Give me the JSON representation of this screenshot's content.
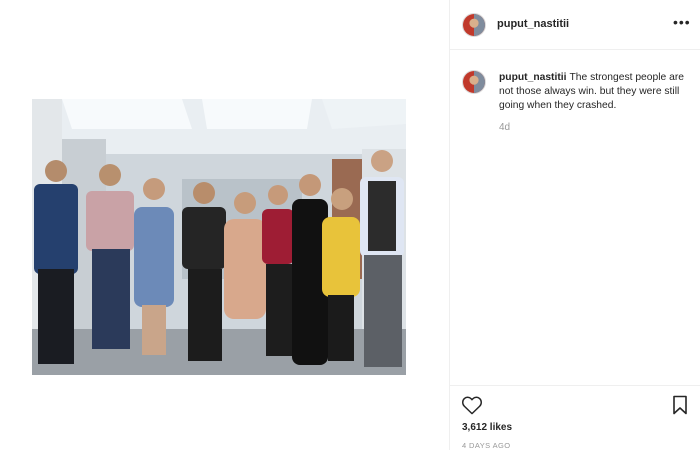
{
  "post": {
    "username": "puput_nastitii",
    "caption": "The strongest people are not those always win. but they were still going when they crashed.",
    "relative_time": "4d",
    "likes": "3,612 likes",
    "date": "4 DAYS AGO"
  },
  "icons": {
    "more": "more-options-icon",
    "like": "heart-icon",
    "save": "bookmark-icon"
  },
  "colors": {
    "text": "#262626",
    "muted": "#999999",
    "border": "#efefef"
  }
}
